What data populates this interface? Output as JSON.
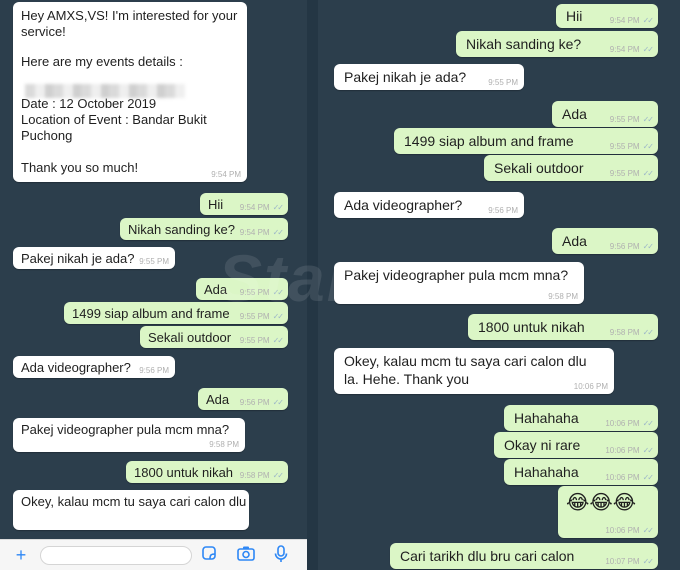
{
  "left": {
    "intro": {
      "line1": "Hey AMXS,VS! I'm interested for your service!",
      "line2": "Here are my events details :",
      "date": "Date : 12 October 2019",
      "location": "Location of Event : Bandar Bukit Puchong",
      "thanks": "Thank you so much!",
      "time": "9:54 PM"
    },
    "messages": [
      {
        "text": "Hii",
        "time": "9:54 PM"
      },
      {
        "text": "Nikah sanding ke?",
        "time": "9:54 PM"
      },
      {
        "text": "Pakej nikah je ada?",
        "time": "9:55 PM"
      },
      {
        "text": "Ada",
        "time": "9:55 PM"
      },
      {
        "text": "1499 siap album and frame",
        "time": "9:55 PM"
      },
      {
        "text": "Sekali outdoor",
        "time": "9:55 PM"
      },
      {
        "text": "Ada videographer?",
        "time": "9:56 PM"
      },
      {
        "text": "Ada",
        "time": "9:56 PM"
      },
      {
        "text": "Pakej videographer pula mcm mna?",
        "time": "9:58 PM"
      },
      {
        "text": "1800 untuk nikah",
        "time": "9:58 PM"
      },
      {
        "text": "Okey, kalau mcm tu saya cari calon dlu",
        "time": ""
      }
    ]
  },
  "right": {
    "messages": [
      {
        "text": "Hii",
        "time": "9:54 PM"
      },
      {
        "text": "Nikah sanding ke?",
        "time": "9:54 PM"
      },
      {
        "text": "Pakej nikah je ada?",
        "time": "9:55 PM"
      },
      {
        "text": "Ada",
        "time": "9:55 PM"
      },
      {
        "text": "1499 siap album and frame",
        "time": "9:55 PM"
      },
      {
        "text": "Sekali outdoor",
        "time": "9:55 PM"
      },
      {
        "text": "Ada videographer?",
        "time": "9:56 PM"
      },
      {
        "text": "Ada",
        "time": "9:56 PM"
      },
      {
        "text": "Pakej videographer pula mcm mna?",
        "time": "9:58 PM"
      },
      {
        "text": "1800 untuk nikah",
        "time": "9:58 PM"
      },
      {
        "text": "Okey, kalau mcm tu saya cari calon dlu",
        "text2": "la. Hehe. Thank you",
        "time": "10:06 PM"
      },
      {
        "text": "Hahahaha",
        "time": "10:06 PM"
      },
      {
        "text": "Okay ni rare",
        "time": "10:06 PM"
      },
      {
        "text": "Hahahaha",
        "time": "10:06 PM"
      },
      {
        "text": "😂😂😂",
        "time": "10:06 PM"
      },
      {
        "text": "Cari tarikh dlu bru cari calon",
        "time": "10:07 PM"
      }
    ]
  },
  "watermark": "Star",
  "ticks": "✓✓",
  "input": {
    "plus_icon": "+",
    "sticker_icon": "sticker-icon",
    "camera_icon": "camera-icon",
    "mic_icon": "microphone-icon"
  },
  "colors": {
    "incoming": "#ffffff",
    "outgoing": "#dbf6c6",
    "background": "#2c3e4c",
    "accent": "#2d87f5"
  }
}
